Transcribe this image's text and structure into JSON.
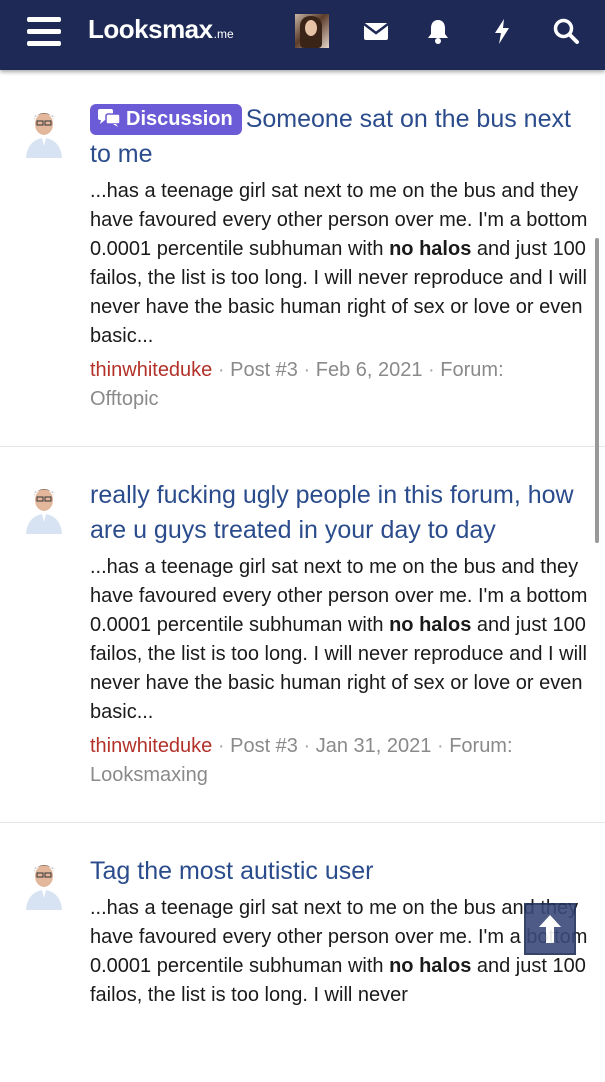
{
  "header": {
    "logo_main": "Looksmax",
    "logo_tld": ".me",
    "icons": [
      "menu-icon",
      "avatar",
      "envelope-icon",
      "bell-icon",
      "bolt-icon",
      "search-icon"
    ]
  },
  "colors": {
    "header_bg": "#1e2a55",
    "link": "#2b4c8c",
    "username": "#b2322a",
    "badge": "#6b5bd6"
  },
  "results": [
    {
      "badge": "Discussion",
      "title": "Someone sat on the bus next to me",
      "snippet_pre": "...has a teenage girl sat next to me on the bus and they have favoured every other person over me. I'm a bottom 0.0001 percentile subhuman with ",
      "snippet_bold": "no halos",
      "snippet_post": " and just 100 failos, the list is too long. I will never reproduce and I will never have the basic human right of sex or love or even basic...",
      "user": "thinwhiteduke",
      "post": "Post #3",
      "date": "Feb 6, 2021",
      "forum_label": "Forum:",
      "forum": "Offtopic"
    },
    {
      "badge": "",
      "title": "really fucking ugly people in this forum, how are u guys treated in your day to day",
      "snippet_pre": "...has a teenage girl sat next to me on the bus and they have favoured every other person over me. I'm a bottom 0.0001 percentile subhuman with ",
      "snippet_bold": "no halos",
      "snippet_post": " and just 100 failos, the list is too long. I will never reproduce and I will never have the basic human right of sex or love or even basic...",
      "user": "thinwhiteduke",
      "post": "Post #3",
      "date": "Jan 31, 2021",
      "forum_label": "Forum:",
      "forum": "Looksmaxing"
    },
    {
      "badge": "",
      "title": "Tag the most autistic user",
      "snippet_pre": "...has a teenage girl sat next to me on the bus and they have favoured every other person over me. I'm a bottom 0.0001 percentile subhuman with ",
      "snippet_bold": "no halos",
      "snippet_post": " and just 100 failos, the list is too long. I will never",
      "user": "",
      "post": "",
      "date": "",
      "forum_label": "",
      "forum": ""
    }
  ],
  "scroll_top_icon": "arrow-up-icon"
}
